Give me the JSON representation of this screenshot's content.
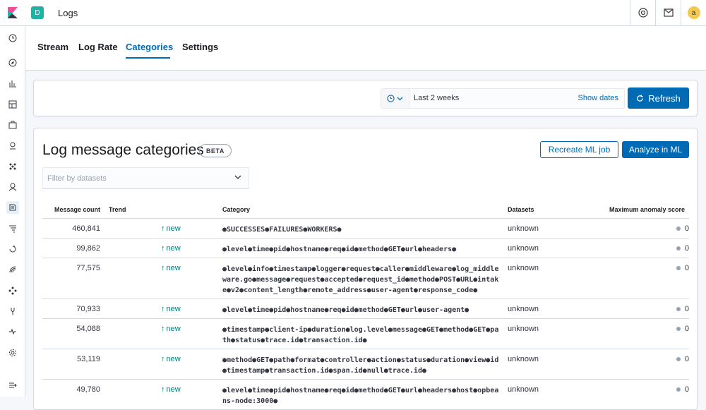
{
  "header": {
    "space_initial": "D",
    "app_title": "Logs",
    "user_initial": "a"
  },
  "tabs": [
    {
      "label": "Stream"
    },
    {
      "label": "Log Rate"
    },
    {
      "label": "Categories",
      "active": true
    },
    {
      "label": "Settings"
    }
  ],
  "date_picker": {
    "range": "Last 2 weeks",
    "show_dates": "Show dates",
    "refresh": "Refresh"
  },
  "panel": {
    "title": "Log message categories",
    "beta": "BETA",
    "recreate_button": "Recreate ML job",
    "analyze_button": "Analyze in ML",
    "filter_placeholder": "Filter by datasets"
  },
  "table": {
    "columns": [
      "Message count",
      "Trend",
      "Category",
      "Datasets",
      "Maximum anomaly score"
    ],
    "rows": [
      {
        "count": "460,841",
        "trend": "new",
        "category": "●SUCCESSES●FAILURES●WORKERS●",
        "dataset": "unknown",
        "score": "0"
      },
      {
        "count": "99,862",
        "trend": "new",
        "category": "●level●time●pid●hostname●req●id●method●GET●url●headers●",
        "dataset": "unknown",
        "score": "0"
      },
      {
        "count": "77,575",
        "trend": "new",
        "category": "●level●info●timestamp●logger●request●caller●middleware●log_middleware.go●message●request●accepted●request_id●method●POST●URL●intake●v2●content_length●remote_address●user-agent●response_code●",
        "dataset": "unknown",
        "score": "0"
      },
      {
        "count": "70,933",
        "trend": "new",
        "category": "●level●time●pid●hostname●req●id●method●GET●url●user-agent●",
        "dataset": "unknown",
        "score": "0"
      },
      {
        "count": "54,088",
        "trend": "new",
        "category": "●timestamp●client-ip●duration●log.level●message●GET●method●GET●path●status●trace.id●transaction.id●",
        "dataset": "unknown",
        "score": "0"
      },
      {
        "count": "53,119",
        "trend": "new",
        "category": "●method●GET●path●format●controller●action●status●duration●view●id●timestamp●transaction.id●span.id●null●trace.id●",
        "dataset": "unknown",
        "score": "0"
      },
      {
        "count": "49,780",
        "trend": "new",
        "category": "●level●time●pid●hostname●req●id●method●GET●url●headers●host●opbeans-node:3000●",
        "dataset": "unknown",
        "score": "0"
      }
    ]
  },
  "colors": {
    "accent": "#006bb4",
    "trend_new": "#017d73",
    "logo": "#e9378d"
  }
}
